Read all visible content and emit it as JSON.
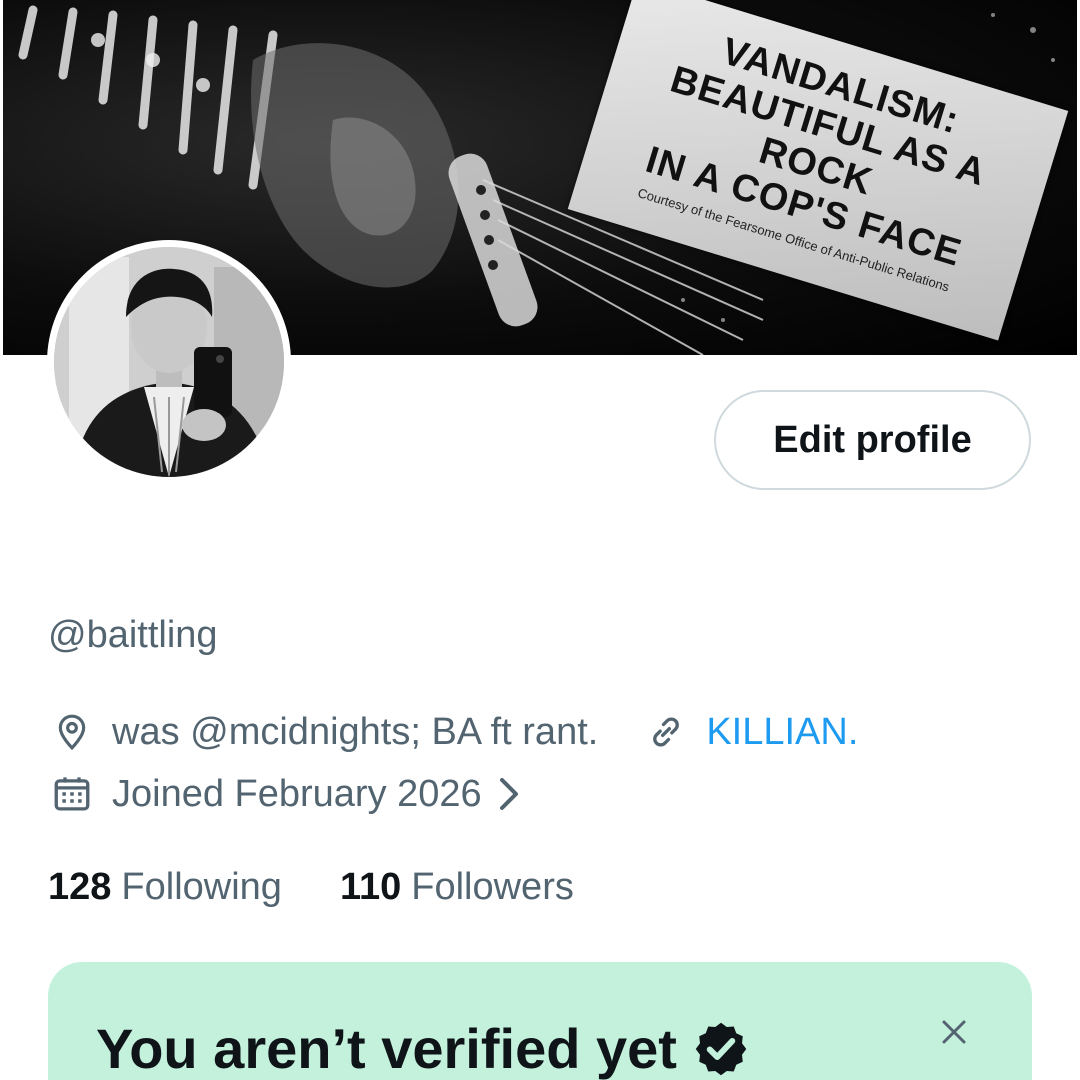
{
  "banner": {
    "sticker_lines": [
      "VANDALISM:",
      "BEAUTIFUL AS A ROCK",
      "IN A COP'S FACE"
    ],
    "sticker_caption": "Courtesy of the Fearsome Office of Anti-Public Relations"
  },
  "profile": {
    "edit_button_label": "Edit profile",
    "handle": "@baittling",
    "location": "was @mcidnights; BA ft rant.",
    "link": "KILLIAN.",
    "joined": "Joined February 2026"
  },
  "stats": {
    "following_count": "128",
    "following_label": "Following",
    "followers_count": "110",
    "followers_label": "Followers"
  },
  "verify_card": {
    "title": "You aren’t verified yet"
  },
  "colors": {
    "link": "#1d9bf0",
    "secondary_text": "#536471",
    "card_bg": "#c3f1dc"
  },
  "icons": [
    "location-icon",
    "link-icon",
    "calendar-icon",
    "chevron-right-icon",
    "verified-badge-icon",
    "close-icon"
  ]
}
